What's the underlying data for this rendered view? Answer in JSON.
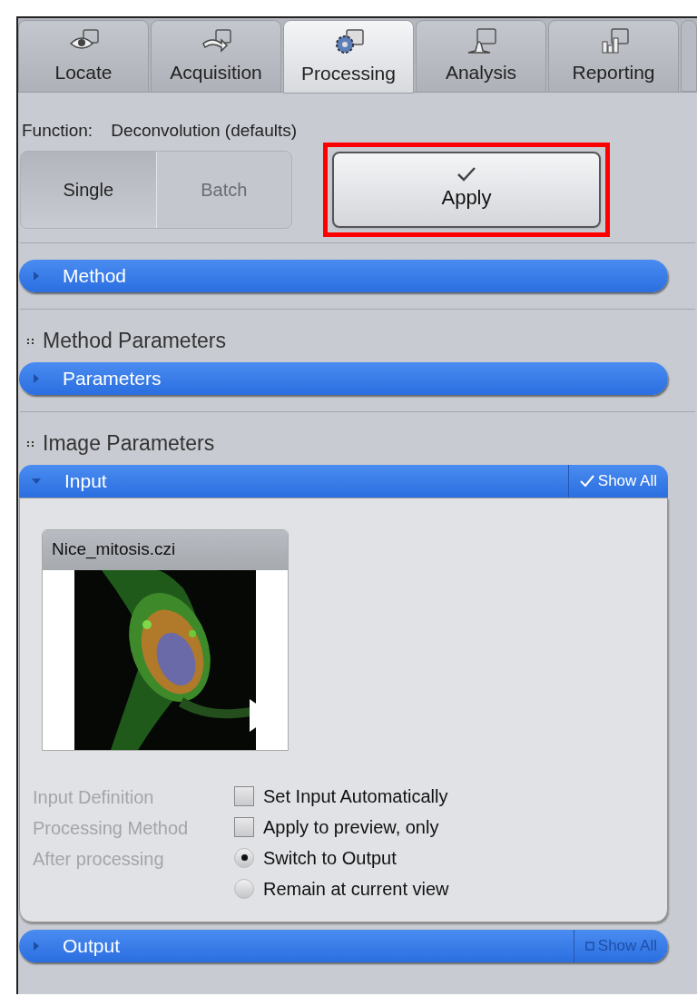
{
  "tabs": [
    {
      "label": "Locate",
      "selected": false
    },
    {
      "label": "Acquisition",
      "selected": false
    },
    {
      "label": "Processing",
      "selected": true
    },
    {
      "label": "Analysis",
      "selected": false
    },
    {
      "label": "Reporting",
      "selected": false
    }
  ],
  "function": {
    "label": "Function:",
    "value": "Deconvolution (defaults)"
  },
  "mode": [
    {
      "label": "Single",
      "selected": true
    },
    {
      "label": "Batch",
      "selected": false
    }
  ],
  "apply_button": {
    "label": "Apply",
    "highlighted": true
  },
  "method": {
    "title": "Method",
    "expanded": false
  },
  "method_parameters": {
    "heading": "Method Parameters",
    "section": {
      "title": "Parameters",
      "expanded": false
    }
  },
  "image_parameters": {
    "heading": "Image Parameters",
    "input": {
      "title": "Input",
      "expanded": true,
      "show_all": {
        "label": "Show All",
        "checked": true
      },
      "thumbnail": {
        "filename": "Nice_mitosis.czi"
      },
      "options": [
        {
          "label": "Input Definition",
          "kind": "checkbox",
          "text": "Set Input Automatically",
          "checked": false
        },
        {
          "label": "Processing Method",
          "kind": "checkbox",
          "text": "Apply to preview, only",
          "checked": false
        },
        {
          "label": "After processing",
          "kind": "radio",
          "text": "Switch to Output",
          "selected": true
        },
        {
          "kind": "radio",
          "text": "Remain at current view",
          "selected": false
        }
      ]
    },
    "output": {
      "title": "Output",
      "expanded": false,
      "show_all": {
        "label": "Show All",
        "checked": false
      }
    }
  }
}
